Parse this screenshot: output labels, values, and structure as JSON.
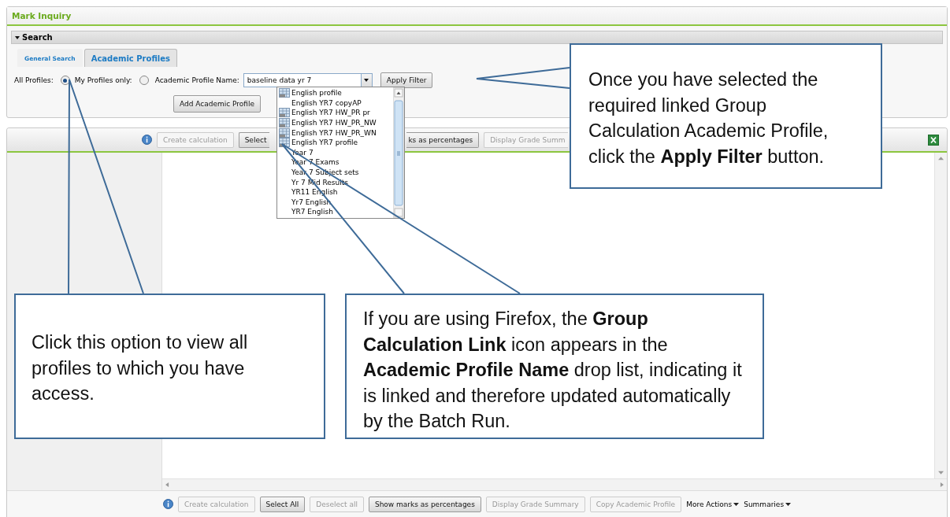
{
  "window": {
    "title": "Mark Inquiry"
  },
  "search": {
    "header": "Search",
    "expanded": true,
    "tabs": [
      {
        "label": "General Search",
        "selected": false
      },
      {
        "label": "Academic Profiles",
        "selected": true
      }
    ],
    "scope_options": [
      {
        "label": "All Profiles:",
        "selected": true
      },
      {
        "label": "My Profiles only:",
        "selected": false
      }
    ],
    "profile_name": {
      "label": "Academic Profile Name:",
      "value": "baseline data yr 7"
    },
    "apply_button": "Apply Filter",
    "add_button": "Add Academic Profile"
  },
  "profile_list": [
    {
      "label": "English profile",
      "linked": true
    },
    {
      "label": "English YR7 copyAP",
      "linked": false
    },
    {
      "label": "English YR7 HW_PR pr",
      "linked": true
    },
    {
      "label": "English YR7 HW_PR_NW",
      "linked": true
    },
    {
      "label": "English YR7 HW_PR_WN",
      "linked": true
    },
    {
      "label": "English YR7 profile",
      "linked": true
    },
    {
      "label": "Year 7",
      "linked": false
    },
    {
      "label": "Year 7 Exams",
      "linked": false
    },
    {
      "label": "Year 7 Subject sets",
      "linked": false
    },
    {
      "label": "Yr 7 Mid Results",
      "linked": false
    },
    {
      "label": "YR11 English",
      "linked": false
    },
    {
      "label": "Yr7 English",
      "linked": false
    },
    {
      "label": "YR7 English",
      "linked": false
    }
  ],
  "results": {
    "top_toolbar": [
      {
        "label": "Create calculation",
        "disabled": true
      },
      {
        "label": "Select",
        "disabled": false
      },
      {
        "label": "ks as percentages",
        "disabled": false
      },
      {
        "label": "Display Grade Summ",
        "disabled": true
      }
    ],
    "bottom_toolbar": [
      {
        "kind": "button",
        "label": "Create calculation",
        "disabled": true
      },
      {
        "kind": "button",
        "label": "Select All",
        "disabled": false
      },
      {
        "kind": "button",
        "label": "Deselect all",
        "disabled": true
      },
      {
        "kind": "button",
        "label": "Show marks as percentages",
        "disabled": false
      },
      {
        "kind": "button",
        "label": "Display Grade Summary",
        "disabled": true
      },
      {
        "kind": "button",
        "label": "Copy Academic Profile",
        "disabled": true
      },
      {
        "kind": "menu",
        "label": "More Actions",
        "disabled": false
      },
      {
        "kind": "menu",
        "label": "Summaries",
        "disabled": false
      }
    ]
  },
  "callouts": [
    {
      "text": "Once you have selected the required linked Group Calculation Academic Profile, click the **Apply Filter** button."
    },
    {
      "text": "Click this option to view all profiles to which you have access."
    },
    {
      "text": "If you are using Firefox, the **Group Calculation Link** icon appears in the **Academic Profile Name** drop list, indicating it is linked and therefore updated automatically by the Batch Run."
    }
  ]
}
